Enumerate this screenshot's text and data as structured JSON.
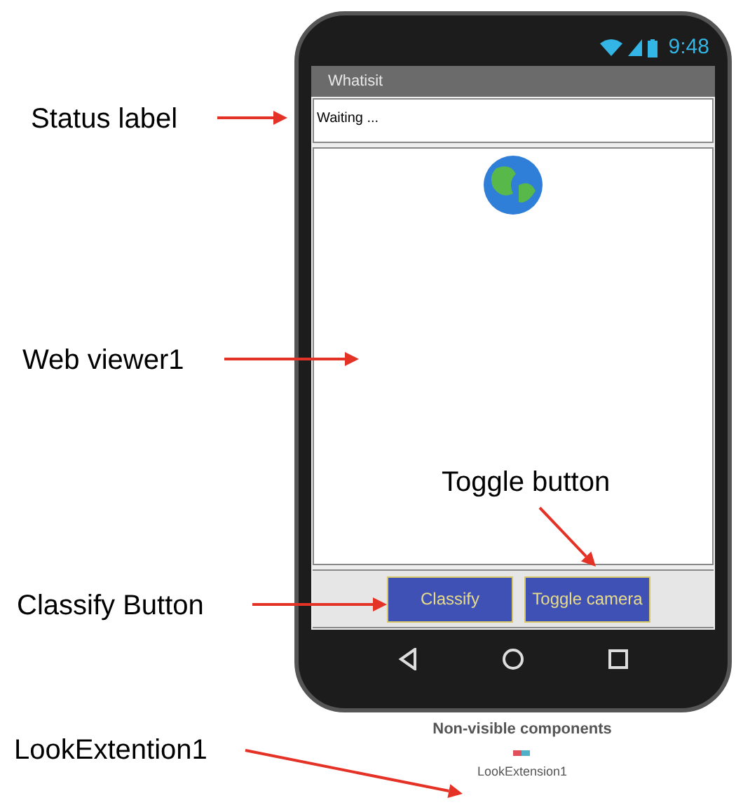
{
  "phone": {
    "status_time": "9:48",
    "app_title": "Whatisit",
    "status_label": "Waiting ...",
    "buttons": [
      "Classify",
      "Toggle camera"
    ]
  },
  "non_visible": {
    "heading": "Non-visible components",
    "items": [
      "LookExtension1"
    ]
  },
  "annotations": [
    {
      "text": "Status label"
    },
    {
      "text": "Web viewer1"
    },
    {
      "text": "Toggle button"
    },
    {
      "text": "Classify Button"
    },
    {
      "text": "LookExtention1"
    }
  ]
}
